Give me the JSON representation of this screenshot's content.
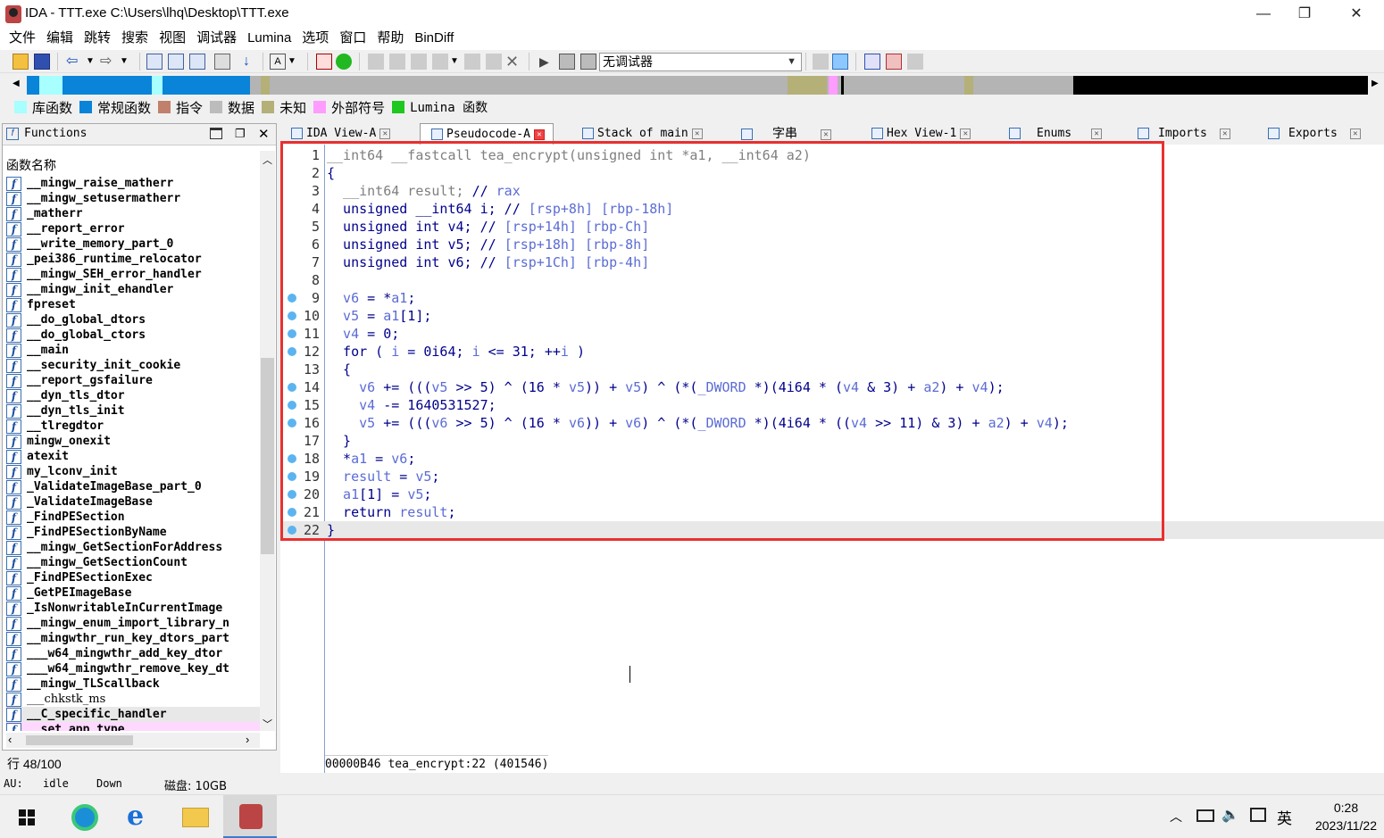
{
  "window": {
    "title": "IDA - TTT.exe C:\\Users\\lhq\\Desktop\\TTT.exe",
    "min": "—",
    "restore": "❐",
    "close": "✕"
  },
  "menu": [
    "文件",
    "编辑",
    "跳转",
    "搜索",
    "视图",
    "调试器",
    "Lumina",
    "选项",
    "窗口",
    "帮助",
    "BinDiff"
  ],
  "toolbar": {
    "debugger_select": "无调试器"
  },
  "legend": [
    {
      "label": "库函数",
      "color": "#a8ffff"
    },
    {
      "label": "常规函数",
      "color": "#0a84d8"
    },
    {
      "label": "指令",
      "color": "#c0806c"
    },
    {
      "label": "数据",
      "color": "#bcbcbc"
    },
    {
      "label": "未知",
      "color": "#b4b078"
    },
    {
      "label": "外部符号",
      "color": "#ff9cff"
    },
    {
      "label": "Lumina 函数",
      "color": "#1ec81e"
    }
  ],
  "functions_panel": {
    "title": "Functions",
    "column_header": "函数名称",
    "items": [
      "__mingw_raise_matherr",
      "__mingw_setusermatherr",
      "_matherr",
      "__report_error",
      "__write_memory_part_0",
      "_pei386_runtime_relocator",
      "__mingw_SEH_error_handler",
      "__mingw_init_ehandler",
      "fpreset",
      "__do_global_dtors",
      "__do_global_ctors",
      "__main",
      "__security_init_cookie",
      "__report_gsfailure",
      "__dyn_tls_dtor",
      "__dyn_tls_init",
      "__tlregdtor",
      "mingw_onexit",
      "atexit",
      "my_lconv_init",
      "_ValidateImageBase_part_0",
      "_ValidateImageBase",
      "_FindPESection",
      "_FindPESectionByName",
      "__mingw_GetSectionForAddress",
      "__mingw_GetSectionCount",
      "_FindPESectionExec",
      "_GetPEImageBase",
      "_IsNonwritableInCurrentImage",
      "__mingw_enum_import_library_n",
      "__mingwthr_run_key_dtors_part",
      "___w64_mingwthr_add_key_dtor",
      "___w64_mingwthr_remove_key_dt",
      "__mingw_TLScallback",
      "___chkstk_ms",
      "__C_specific_handler",
      "__set_app_type"
    ],
    "row_count": "行 48/100"
  },
  "tabs": [
    {
      "label": "IDA View-A",
      "active": false
    },
    {
      "label": "Pseudocode-A",
      "active": true
    },
    {
      "label": "Stack of main",
      "active": false
    },
    {
      "label": "字串",
      "active": false
    },
    {
      "label": "Hex View-1",
      "active": false
    },
    {
      "label": "Enums",
      "active": false
    },
    {
      "label": "Imports",
      "active": false
    },
    {
      "label": "Exports",
      "active": false
    }
  ],
  "pseudocode": {
    "lines": [
      {
        "n": "1",
        "bp": false
      },
      {
        "n": "2",
        "bp": false
      },
      {
        "n": "3",
        "bp": false
      },
      {
        "n": "4",
        "bp": false
      },
      {
        "n": "5",
        "bp": false
      },
      {
        "n": "6",
        "bp": false
      },
      {
        "n": "7",
        "bp": false
      },
      {
        "n": "8",
        "bp": false
      },
      {
        "n": "9",
        "bp": true
      },
      {
        "n": "10",
        "bp": true
      },
      {
        "n": "11",
        "bp": true
      },
      {
        "n": "12",
        "bp": true
      },
      {
        "n": "13",
        "bp": false
      },
      {
        "n": "14",
        "bp": true
      },
      {
        "n": "15",
        "bp": true
      },
      {
        "n": "16",
        "bp": true
      },
      {
        "n": "17",
        "bp": false
      },
      {
        "n": "18",
        "bp": true
      },
      {
        "n": "19",
        "bp": true
      },
      {
        "n": "20",
        "bp": true
      },
      {
        "n": "21",
        "bp": true
      },
      {
        "n": "22",
        "bp": true
      }
    ],
    "code": [
      [
        [
          "gv",
          "__int64 __fastcall tea_encrypt(unsigned int *a1, __int64 a2)"
        ]
      ],
      [
        [
          "kw",
          "{"
        ]
      ],
      [
        [
          "gv",
          "  __int64 result; "
        ],
        [
          "kw",
          "// "
        ],
        [
          "cm",
          "rax"
        ]
      ],
      [
        [
          "kw",
          "  unsigned __int64 i; // "
        ],
        [
          "cm",
          "[rsp+8h] [rbp-18h]"
        ]
      ],
      [
        [
          "kw",
          "  unsigned int v4; // "
        ],
        [
          "cm",
          "[rsp+14h] [rbp-Ch]"
        ]
      ],
      [
        [
          "kw",
          "  unsigned int v5; // "
        ],
        [
          "cm",
          "[rsp+18h] [rbp-8h]"
        ]
      ],
      [
        [
          "kw",
          "  unsigned int v6; // "
        ],
        [
          "cm",
          "[rsp+1Ch] [rbp-4h]"
        ]
      ],
      [
        [
          "kw",
          ""
        ]
      ],
      [
        [
          "vr",
          "  v6"
        ],
        [
          "kw",
          " = *"
        ],
        [
          "vr",
          "a1"
        ],
        [
          "kw",
          ";"
        ]
      ],
      [
        [
          "vr",
          "  v5"
        ],
        [
          "kw",
          " = "
        ],
        [
          "vr",
          "a1"
        ],
        [
          "kw",
          "[1];"
        ]
      ],
      [
        [
          "vr",
          "  v4"
        ],
        [
          "kw",
          " = 0;"
        ]
      ],
      [
        [
          "kw",
          "  for ( "
        ],
        [
          "vr",
          "i"
        ],
        [
          "kw",
          " = 0i64; "
        ],
        [
          "vr",
          "i"
        ],
        [
          "kw",
          " <= 31; ++"
        ],
        [
          "vr",
          "i"
        ],
        [
          "kw",
          " )"
        ]
      ],
      [
        [
          "kw",
          "  {"
        ]
      ],
      [
        [
          "vr",
          "    v6"
        ],
        [
          "kw",
          " += ((("
        ],
        [
          "vr",
          "v5"
        ],
        [
          "kw",
          " >> 5) ^ (16 * "
        ],
        [
          "vr",
          "v5"
        ],
        [
          "kw",
          ")) + "
        ],
        [
          "vr",
          "v5"
        ],
        [
          "kw",
          ") ^ (*("
        ],
        [
          "vr",
          "_DWORD"
        ],
        [
          "kw",
          " *)(4i64 * ("
        ],
        [
          "vr",
          "v4"
        ],
        [
          "kw",
          " & 3) + "
        ],
        [
          "vr",
          "a2"
        ],
        [
          "kw",
          ") + "
        ],
        [
          "vr",
          "v4"
        ],
        [
          "kw",
          ");"
        ]
      ],
      [
        [
          "vr",
          "    v4"
        ],
        [
          "kw",
          " -= 1640531527;"
        ]
      ],
      [
        [
          "vr",
          "    v5"
        ],
        [
          "kw",
          " += ((("
        ],
        [
          "vr",
          "v6"
        ],
        [
          "kw",
          " >> 5) ^ (16 * "
        ],
        [
          "vr",
          "v6"
        ],
        [
          "kw",
          ")) + "
        ],
        [
          "vr",
          "v6"
        ],
        [
          "kw",
          ") ^ (*("
        ],
        [
          "vr",
          "_DWORD"
        ],
        [
          "kw",
          " *)(4i64 * (("
        ],
        [
          "vr",
          "v4"
        ],
        [
          "kw",
          " >> 11) & 3) + "
        ],
        [
          "vr",
          "a2"
        ],
        [
          "kw",
          ") + "
        ],
        [
          "vr",
          "v4"
        ],
        [
          "kw",
          ");"
        ]
      ],
      [
        [
          "kw",
          "  }"
        ]
      ],
      [
        [
          "kw",
          "  *"
        ],
        [
          "vr",
          "a1"
        ],
        [
          "kw",
          " = "
        ],
        [
          "vr",
          "v6"
        ],
        [
          "kw",
          ";"
        ]
      ],
      [
        [
          "vr",
          "  result"
        ],
        [
          "kw",
          " = "
        ],
        [
          "vr",
          "v5"
        ],
        [
          "kw",
          ";"
        ]
      ],
      [
        [
          "vr",
          "  a1"
        ],
        [
          "kw",
          "[1] = "
        ],
        [
          "vr",
          "v5"
        ],
        [
          "kw",
          ";"
        ]
      ],
      [
        [
          "kw",
          "  return "
        ],
        [
          "vr",
          "result"
        ],
        [
          "kw",
          ";"
        ]
      ],
      [
        [
          "kw",
          "}"
        ]
      ]
    ],
    "status": "00000B46 tea_encrypt:22 (401546)"
  },
  "statusbar": {
    "au": "AU:",
    "state": "idle",
    "dir": "Down",
    "disk": "磁盘: 10GB"
  },
  "taskbar": {
    "time": "0:28",
    "date": "2023/11/22",
    "ime": "英"
  }
}
